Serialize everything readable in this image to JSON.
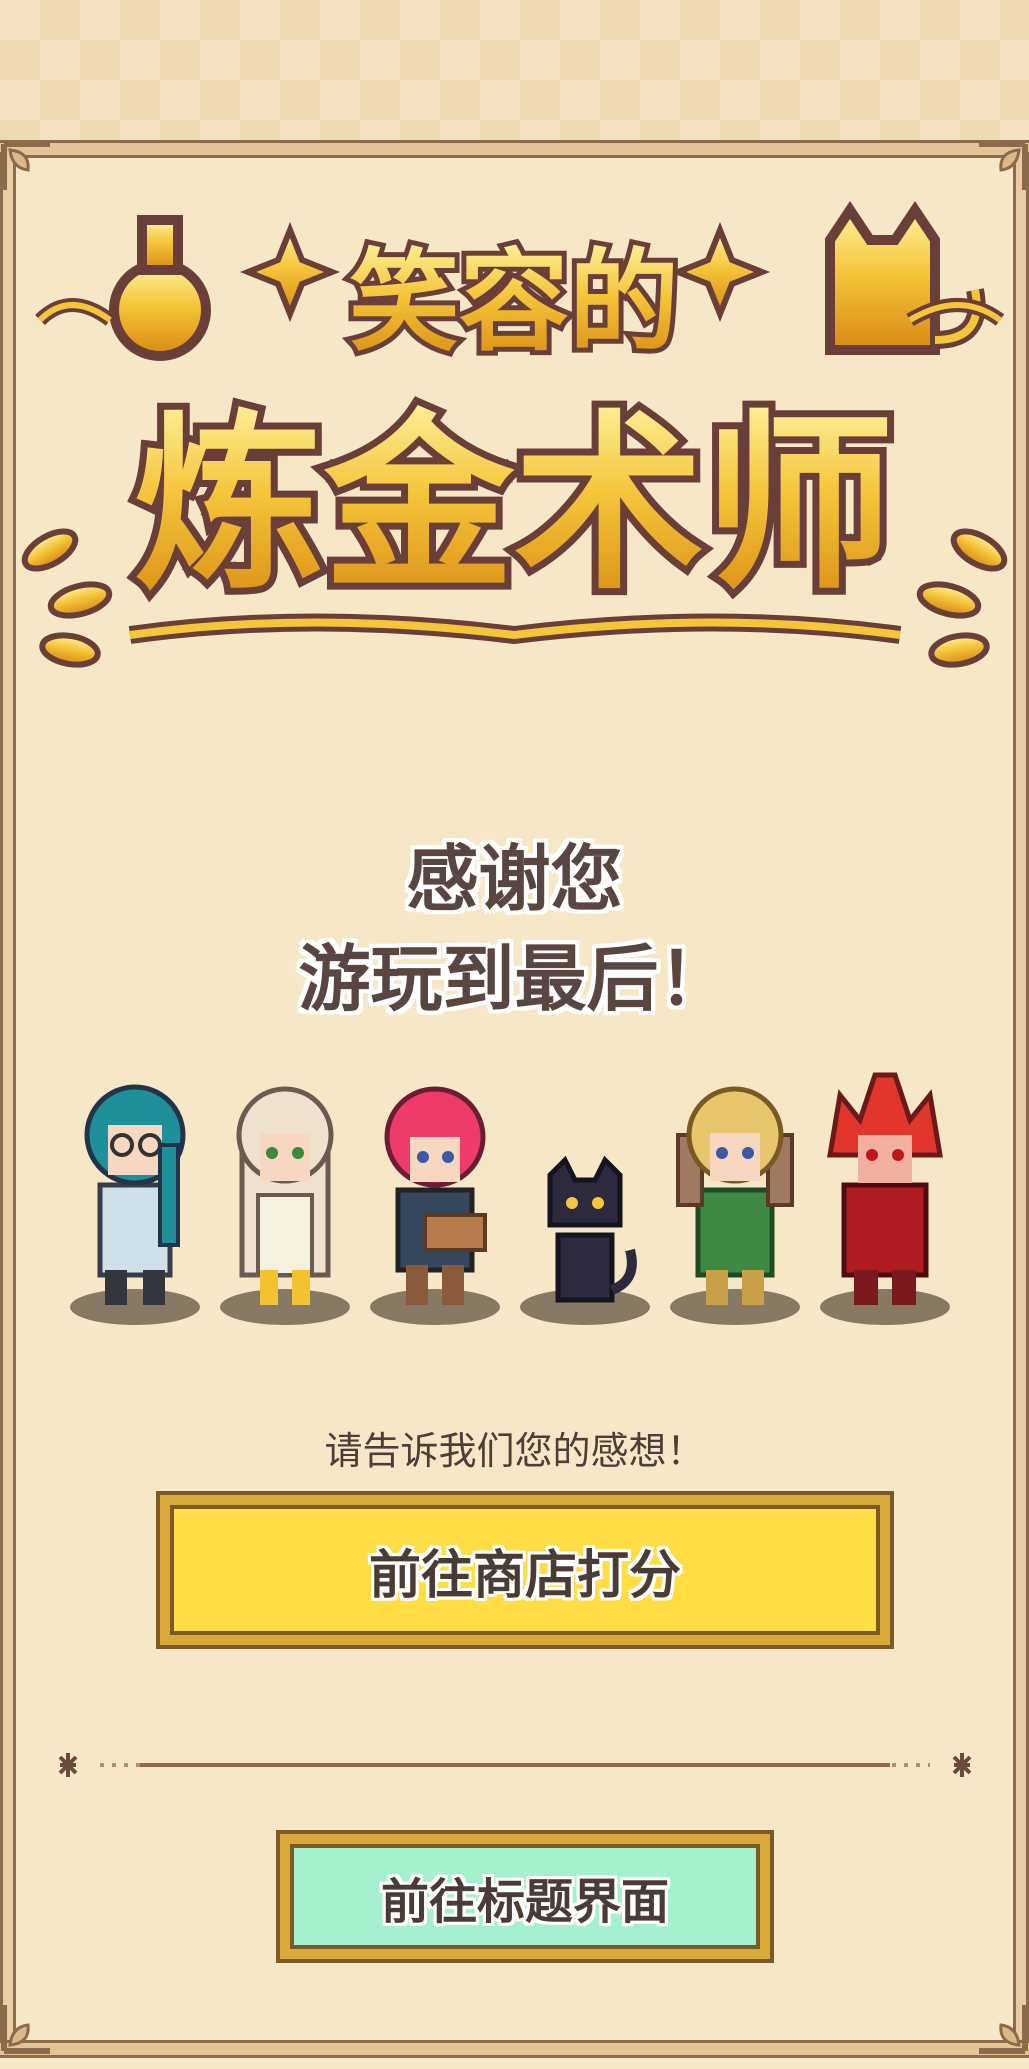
{
  "logo": {
    "line1": "笑容的",
    "line2": "炼金术师"
  },
  "thanks": {
    "line1": "感谢您",
    "line2": "游玩到最后！"
  },
  "characters": [
    {
      "name": "teal-haired-character",
      "hair": "#1f8f9a",
      "outfit": "#cfe0ea"
    },
    {
      "name": "blonde-girl-character",
      "hair": "#efe1cf",
      "outfit": "#f5f1e0"
    },
    {
      "name": "pink-haired-character",
      "hair": "#ef3b6a",
      "outfit": "#34475d"
    },
    {
      "name": "black-cat-character",
      "hair": "#2d2a3e",
      "outfit": "#2d2a3e"
    },
    {
      "name": "green-outfit-character",
      "hair": "#e9c56b",
      "outfit": "#3e8a42"
    },
    {
      "name": "red-armor-character",
      "hair": "#e2352c",
      "outfit": "#b01b22"
    }
  ],
  "feedback_prompt": "请告诉我们您的感想！",
  "buttons": {
    "rate": "前往商店打分",
    "title": "前往标题界面"
  },
  "colors": {
    "background": "#f6e8c7",
    "gold": "#f2b81f",
    "rate_button": "#ffde45",
    "title_button": "#a6f1cd"
  }
}
